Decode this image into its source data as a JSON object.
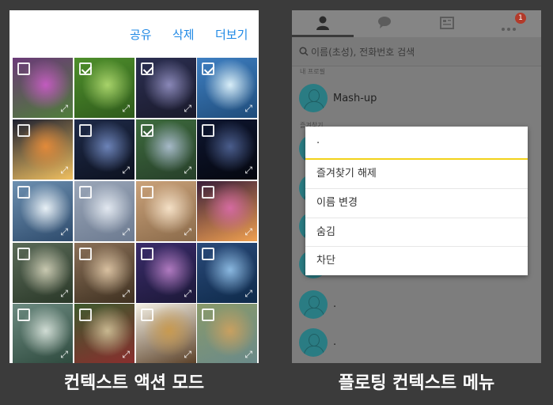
{
  "left": {
    "actions": {
      "share": "공유",
      "delete": "삭제",
      "more": "더보기"
    },
    "caption": "컨텍스트 액션 모드",
    "tiles": [
      {
        "checked": false,
        "colors": [
          "#6b3a78",
          "#c25bbf",
          "#4f7d3a"
        ]
      },
      {
        "checked": true,
        "colors": [
          "#4e8f2b",
          "#a8d36a",
          "#2f5a1c"
        ]
      },
      {
        "checked": true,
        "colors": [
          "#2b2f52",
          "#8a88b8",
          "#1a1a2b"
        ]
      },
      {
        "checked": true,
        "colors": [
          "#3e7fc2",
          "#d8eef8",
          "#1f4c7a"
        ]
      },
      {
        "checked": false,
        "colors": [
          "#1d2030",
          "#e28a3a",
          "#f0c060"
        ]
      },
      {
        "checked": false,
        "colors": [
          "#1e2a48",
          "#6c83b8",
          "#0d1220"
        ]
      },
      {
        "checked": true,
        "colors": [
          "#3d6b3d",
          "#a6b9c8",
          "#273f2a"
        ]
      },
      {
        "checked": false,
        "colors": [
          "#0e1630",
          "#4a5d8c",
          "#05070f"
        ]
      },
      {
        "checked": false,
        "colors": [
          "#6c8fb0",
          "#e8f0f6",
          "#2e4b6c"
        ]
      },
      {
        "checked": false,
        "colors": [
          "#9aa6b8",
          "#e2e8f0",
          "#6c7a90"
        ]
      },
      {
        "checked": false,
        "colors": [
          "#caa27a",
          "#f4e0c6",
          "#8a6a4a"
        ]
      },
      {
        "checked": false,
        "colors": [
          "#3a1e3a",
          "#d46aa0",
          "#f0a050"
        ]
      },
      {
        "checked": false,
        "colors": [
          "#5a6a58",
          "#c8c8b0",
          "#2a3828"
        ]
      },
      {
        "checked": false,
        "colors": [
          "#8a7058",
          "#d8c0a0",
          "#3e3020"
        ]
      },
      {
        "checked": false,
        "colors": [
          "#3a2c6a",
          "#b07ac0",
          "#1c1838"
        ]
      },
      {
        "checked": false,
        "colors": [
          "#2a4a7a",
          "#8ab8e0",
          "#0e2a4a"
        ]
      },
      {
        "checked": false,
        "colors": [
          "#6c8a80",
          "#d0dcd4",
          "#2e4a3e"
        ]
      },
      {
        "checked": false,
        "colors": [
          "#3e5a2e",
          "#c8b890",
          "#8a2e2e"
        ]
      },
      {
        "checked": false,
        "colors": [
          "#f4f0e4",
          "#c89a50",
          "#5a4028"
        ]
      },
      {
        "checked": false,
        "colors": [
          "#8a9a6a",
          "#c8a060",
          "#6a8a8a"
        ]
      }
    ]
  },
  "right": {
    "tabs": {
      "badge": "1"
    },
    "search_placeholder": "이름(초성), 전화번호 검색",
    "section_my_profile": "내 프로필",
    "profile_name": "Mash-up",
    "section_favorites": "즐겨찾기",
    "popup": {
      "title": ".",
      "items": [
        "즐겨찾기 해제",
        "이름 변경",
        "숨김",
        "차단"
      ]
    },
    "list_below": [
      ".",
      "."
    ],
    "caption": "플로팅 컨텍스트 메뉴"
  }
}
